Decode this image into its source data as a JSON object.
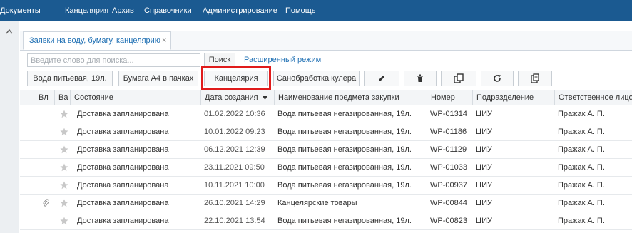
{
  "menu": [
    "Документы",
    "Канцелярия",
    "Архив",
    "Справочники",
    "Администрирование",
    "Помощь"
  ],
  "tab": {
    "label": "Заявки на воду, бумагу, канцелярию",
    "close": "×"
  },
  "search": {
    "placeholder": "Введите слово для поиска...",
    "button": "Поиск",
    "advanced": "Расширенный режим"
  },
  "toolbar": {
    "btn1": "Вода питьевая, 19л.",
    "btn2": "Бумага А4 в пачках",
    "btn3": "Канцелярия",
    "btn4": "Санобработка кулера",
    "icons": [
      "pencil-icon",
      "trash-icon",
      "copy-icon",
      "refresh-icon",
      "export-icon"
    ]
  },
  "columns": {
    "vl": "Вл",
    "va": "Ва",
    "state": "Состояние",
    "date": "Дата создания",
    "name": "Наименование предмета закупки",
    "num": "Номер",
    "dep": "Подразделение",
    "resp": "Ответственное лицо"
  },
  "rows": [
    {
      "state": "Доставка запланирована",
      "date": "01.02.2022 10:36",
      "name": "Вода питьевая негазированная, 19л.",
      "num": "WP-01314",
      "dep": "ЦИУ",
      "resp": "Пражак А. П.",
      "clip": false
    },
    {
      "state": "Доставка запланирована",
      "date": "10.01.2022 09:23",
      "name": "Вода питьевая негазированная, 19л.",
      "num": "WP-01186",
      "dep": "ЦИУ",
      "resp": "Пражак А. П.",
      "clip": false
    },
    {
      "state": "Доставка запланирована",
      "date": "06.12.2021 12:39",
      "name": "Вода питьевая негазированная, 19л.",
      "num": "WP-01129",
      "dep": "ЦИУ",
      "resp": "Пражак А. П.",
      "clip": false
    },
    {
      "state": "Доставка запланирована",
      "date": "23.11.2021 09:50",
      "name": "Вода питьевая негазированная, 19л.",
      "num": "WP-01033",
      "dep": "ЦИУ",
      "resp": "Пражак А. П.",
      "clip": false
    },
    {
      "state": "Доставка запланирована",
      "date": "10.11.2021 10:00",
      "name": "Вода питьевая негазированная, 19л.",
      "num": "WP-00937",
      "dep": "ЦИУ",
      "resp": "Пражак А. П.",
      "clip": false
    },
    {
      "state": "Доставка запланирована",
      "date": "26.10.2021 14:29",
      "name": "Канцелярские товары",
      "num": "WP-00844",
      "dep": "ЦИУ",
      "resp": "Пражак А. П.",
      "clip": true
    },
    {
      "state": "Доставка запланирована",
      "date": "22.10.2021 13:54",
      "name": "Вода питьевая негазированная, 19л.",
      "num": "WP-00823",
      "dep": "ЦИУ",
      "resp": "Пражак А. П.",
      "clip": false
    }
  ],
  "colors": {
    "menubar": "#1b5a91",
    "link": "#1e6fb3",
    "highlight": "#e01b1b",
    "star": "#c8c8c8"
  }
}
